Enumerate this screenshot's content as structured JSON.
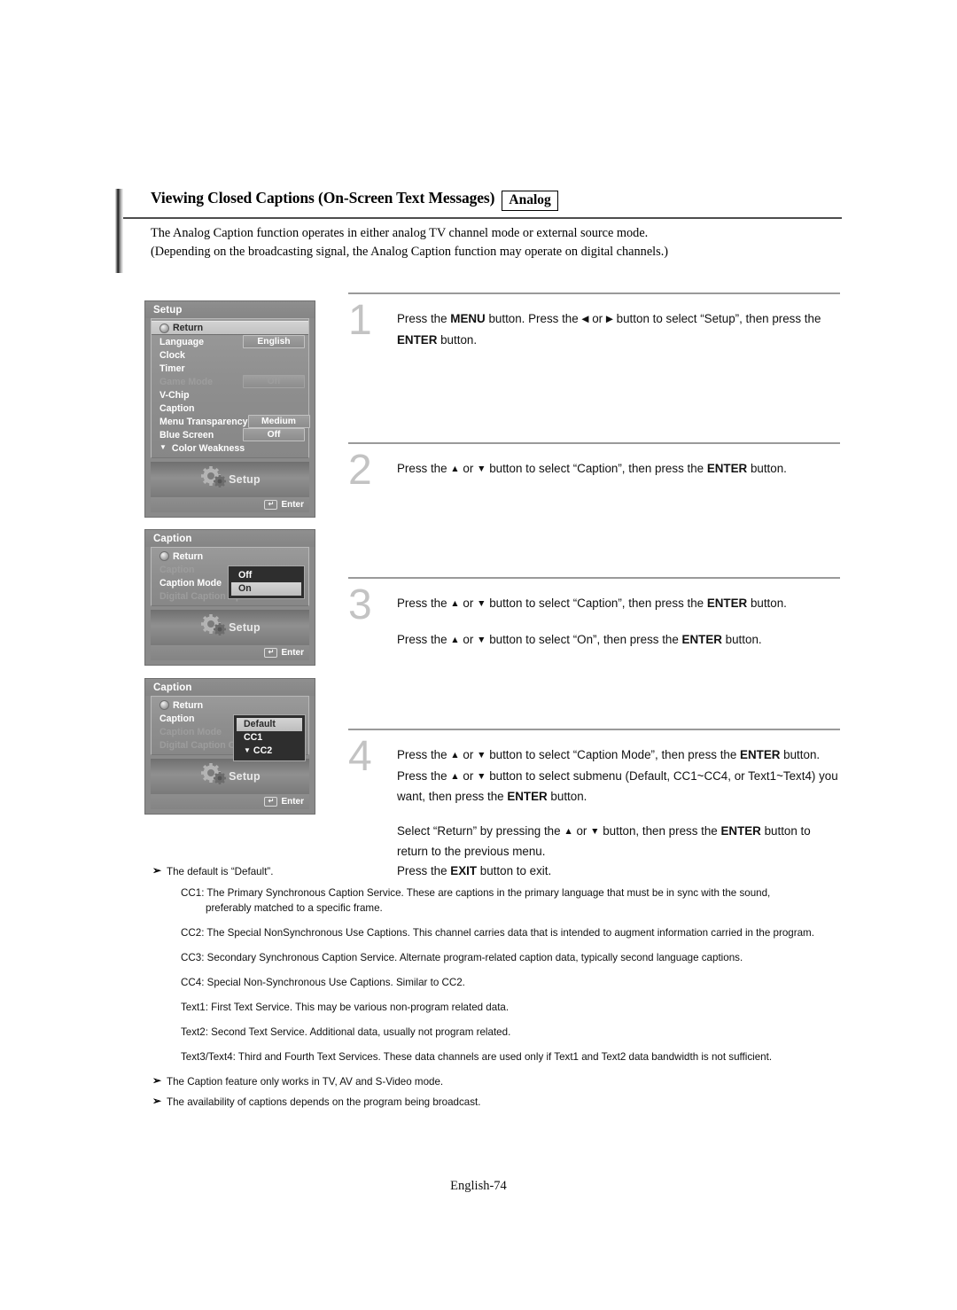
{
  "header": {
    "title": "Viewing Closed Captions (On-Screen Text Messages)",
    "badge": "Analog",
    "intro_line1": "The Analog Caption function operates in either analog TV channel mode or external source mode.",
    "intro_line2": "(Depending on the broadcasting signal, the Analog Caption function may operate on digital channels.)"
  },
  "steps": [
    {
      "number": "1",
      "lines": [
        "Press the <b>MENU</b> button. Press the <span class=\"arrow\">◀</span> or <span class=\"arrow\">▶</span> button to select “Setup”, then press the <b>ENTER</b> button."
      ]
    },
    {
      "number": "2",
      "lines": [
        "Press the <span class=\"arrow\">▲</span> or <span class=\"arrow\">▼</span> button to select “Caption”, then press the <b>ENTER</b> button."
      ]
    },
    {
      "number": "3",
      "lines": [
        "Press the <span class=\"arrow\">▲</span> or <span class=\"arrow\">▼</span> button to select “Caption”, then press the <b>ENTER</b> button.",
        "Press the <span class=\"arrow\">▲</span> or <span class=\"arrow\">▼</span> button to select “On”, then press the <b>ENTER</b> button."
      ]
    },
    {
      "number": "4",
      "lines": [
        "Press the <span class=\"arrow\">▲</span> or <span class=\"arrow\">▼</span> button to select “Caption Mode”, then press the <b>ENTER</b> button.",
        "Press the <span class=\"arrow\">▲</span> or <span class=\"arrow\">▼</span> button to select submenu (Default, CC1~CC4, or Text1~Text4) you want, then press the <b>ENTER</b> button.",
        "Select “Return” by pressing the <span class=\"arrow\">▲</span> or <span class=\"arrow\">▼</span> button, then press the <b>ENTER</b> button to return to the previous menu.<br>Press the <b>EXIT</b> button to exit."
      ]
    }
  ],
  "osd": {
    "setup_menu": {
      "title": "Setup",
      "brand_label": "Setup",
      "enter_label": "Enter",
      "rows": [
        {
          "label": "Return",
          "value": "",
          "state": "selected",
          "icon": "return-icon"
        },
        {
          "label": "Language",
          "value": "English",
          "state": "normal"
        },
        {
          "label": "Clock",
          "value": "",
          "state": "normal"
        },
        {
          "label": "Timer",
          "value": "",
          "state": "normal"
        },
        {
          "label": "Game Mode",
          "value": "Off",
          "state": "disabled"
        },
        {
          "label": "V-Chip",
          "value": "",
          "state": "normal"
        },
        {
          "label": "Caption",
          "value": "",
          "state": "normal"
        },
        {
          "label": "Menu Transparency",
          "value": "Medium",
          "state": "normal"
        },
        {
          "label": "Blue Screen",
          "value": "Off",
          "state": "normal"
        },
        {
          "label": "Color Weakness",
          "value": "",
          "state": "normal",
          "caret": "▼"
        }
      ]
    },
    "caption_menu_on": {
      "title": "Caption",
      "brand_label": "Setup",
      "enter_label": "Enter",
      "rows": [
        {
          "label": "Return",
          "value": "",
          "state": "normal",
          "icon": "return-icon"
        },
        {
          "label": "Caption",
          "value": "",
          "state": "disabled"
        },
        {
          "label": "Caption Mode",
          "value": "",
          "state": "normal"
        },
        {
          "label": "Digital Caption Options",
          "value": "",
          "state": "disabled"
        }
      ],
      "dropdown": [
        {
          "label": "Off",
          "selected": false
        },
        {
          "label": "On",
          "selected": true
        }
      ]
    },
    "caption_menu_mode": {
      "title": "Caption",
      "brand_label": "Setup",
      "enter_label": "Enter",
      "rows": [
        {
          "label": "Return",
          "value": "",
          "state": "normal",
          "icon": "return-icon"
        },
        {
          "label": "Caption",
          "value": "",
          "state": "normal"
        },
        {
          "label": "Caption Mode",
          "value": "",
          "state": "disabled"
        },
        {
          "label": "Digital Caption Opti",
          "value": "",
          "state": "disabled"
        }
      ],
      "dropdown": [
        {
          "label": "Default",
          "selected": true
        },
        {
          "label": "CC1",
          "selected": false
        },
        {
          "label": "CC2",
          "selected": false,
          "caret": "▼"
        }
      ]
    }
  },
  "notes": {
    "default_note": "The default is “Default”.",
    "definitions": [
      {
        "term": "CC1",
        "text": ": The Primary Synchronous Caption Service. These are captions in the primary language that must be in sync with the sound,",
        "cont": "preferably matched to a specific frame."
      },
      {
        "term": "CC2",
        "text": ": The Special NonSynchronous Use Captions. This channel carries data that is intended to augment information carried in the program.",
        "cont": ""
      },
      {
        "term": "CC3",
        "text": ": Secondary Synchronous Caption Service. Alternate program-related caption data, typically second language captions.",
        "cont": ""
      },
      {
        "term": "CC4",
        "text": ": Special Non-Synchronous Use Captions. Similar to CC2.",
        "cont": ""
      },
      {
        "term": "Text1",
        "text": ": First Text Service. This may be various non-program related data.",
        "cont": ""
      },
      {
        "term": "Text2",
        "text": ": Second Text Service. Additional data, usually not program related.",
        "cont": ""
      },
      {
        "term": "Text3/Text4",
        "text": ": Third and Fourth Text Services. These data channels are used only if Text1 and Text2 data bandwidth is not sufficient.",
        "cont": ""
      }
    ],
    "footer_notes": [
      "The Caption feature only works in TV, AV and S-Video mode.",
      "The availability of captions depends on the program being broadcast."
    ],
    "bullet_glyph": "➢"
  },
  "footer": {
    "page_label": "English-74"
  }
}
